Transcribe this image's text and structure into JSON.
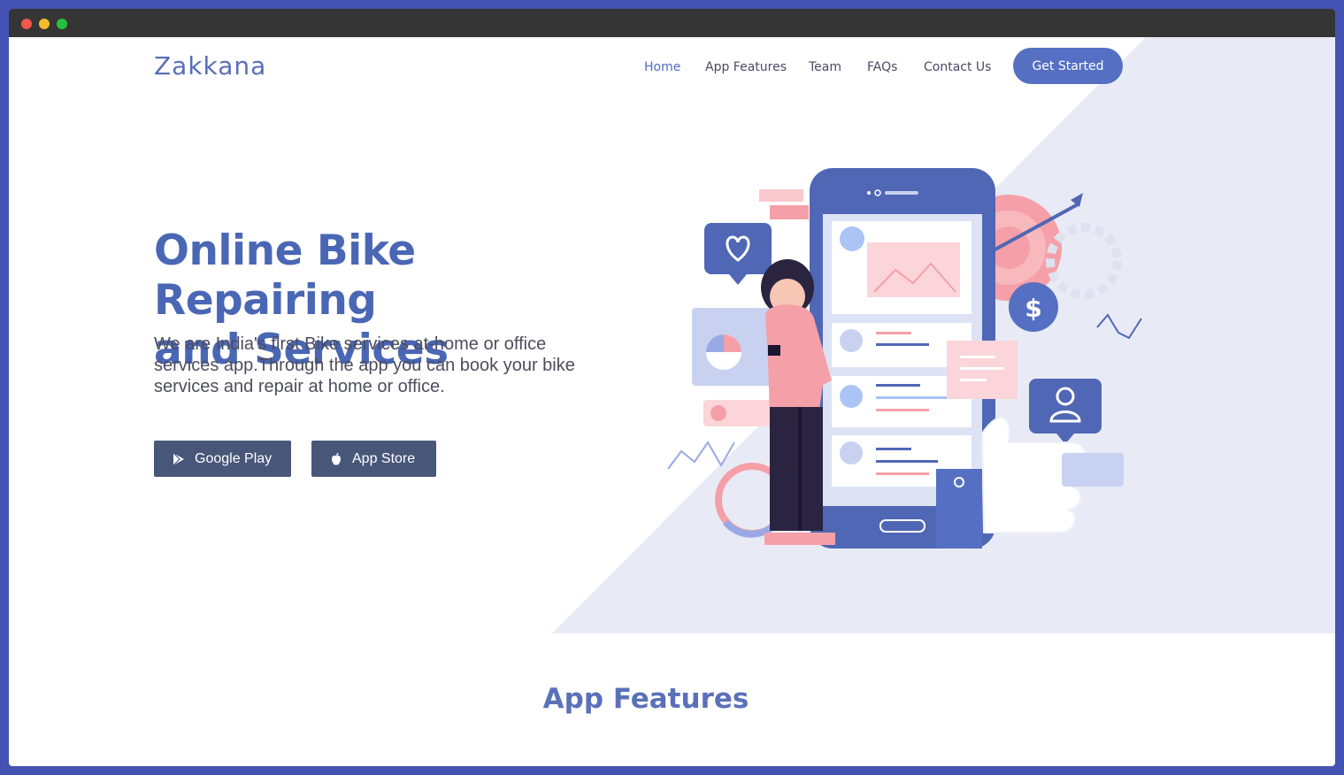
{
  "brand": "Zakkana",
  "nav": {
    "items": [
      "Home",
      "App Features",
      "Team",
      "FAQs",
      "Contact Us"
    ],
    "cta": "Get Started"
  },
  "hero": {
    "title_line1": "Online Bike Repairing",
    "title_line2": "and Services",
    "subtitle_line1": "We are India's first Bike services at-home or office",
    "subtitle_line2": "services app.Through the app you can book your bike",
    "subtitle_line3": "services and repair at home or office.",
    "buttons": {
      "google_play": "Google Play",
      "app_store": "App Store"
    }
  },
  "sections": {
    "features_title": "App Features"
  },
  "colors": {
    "brand": "#5a6fb8",
    "accent": "#5570c2",
    "store_button": "#485779",
    "hero_panel": "#e8ebf6",
    "pink": "#f5a0a8"
  },
  "icons": [
    "google-play-icon",
    "apple-icon",
    "heart-icon",
    "dollar-icon",
    "user-icon"
  ]
}
